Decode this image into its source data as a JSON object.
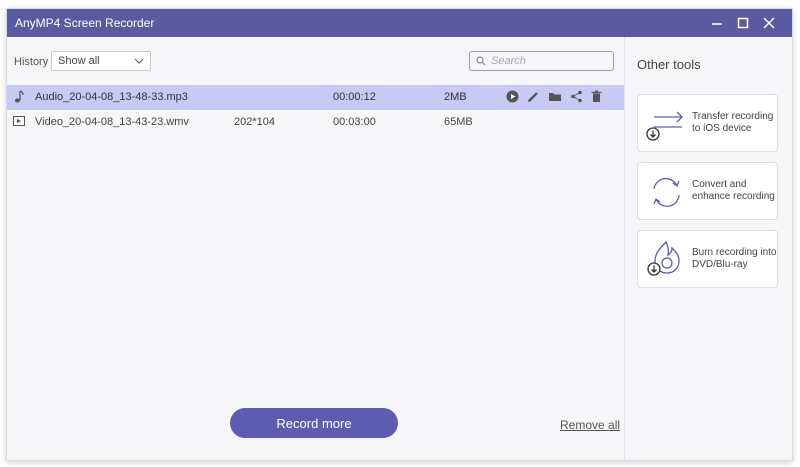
{
  "window": {
    "title": "AnyMP4 Screen Recorder"
  },
  "toolbar": {
    "history_label": "History",
    "history_selected": "Show all",
    "search_placeholder": "Search"
  },
  "recordings": [
    {
      "type_icon": "music-note-icon",
      "name": "Audio_20-04-08_13-48-33.mp3",
      "resolution": "",
      "duration": "00:00:12",
      "size": "2MB",
      "selected": true
    },
    {
      "type_icon": "video-file-icon",
      "name": "Video_20-04-08_13-43-23.wmv",
      "resolution": "202*104",
      "duration": "00:03:00",
      "size": "65MB",
      "selected": false
    }
  ],
  "row_actions": [
    "play-icon",
    "edit-icon",
    "folder-icon",
    "share-icon",
    "delete-icon"
  ],
  "footer": {
    "record_more": "Record more",
    "remove_all": "Remove all"
  },
  "side": {
    "title": "Other tools",
    "tools": [
      {
        "icon": "transfer-icon",
        "label": "Transfer recording to iOS device"
      },
      {
        "icon": "convert-icon",
        "label": "Convert and enhance recording"
      },
      {
        "icon": "burn-disc-icon",
        "label": "Burn recording into DVD/Blu-ray"
      }
    ]
  },
  "colors": {
    "titlebar": "#5a5a9e",
    "accent": "#5d5db0",
    "selected_row": "#c9c9f5"
  }
}
